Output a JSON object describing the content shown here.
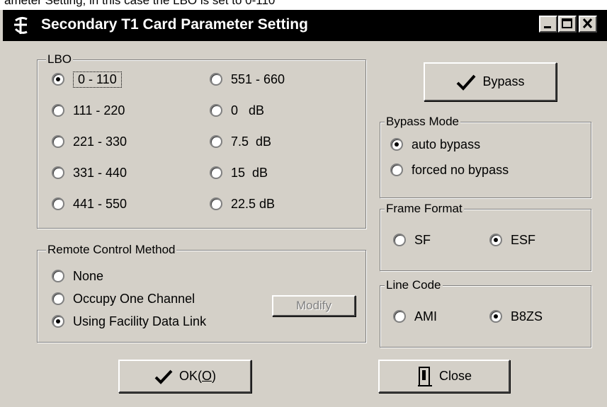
{
  "top_strip": {
    "text": "ameter Setting, in this case the LBO is set to 0-110"
  },
  "window": {
    "title": "Secondary T1 Card Parameter Setting"
  },
  "lbo": {
    "legend": "LBO",
    "options": [
      {
        "label": "0 - 110",
        "selected": true
      },
      {
        "label": "111 - 220",
        "selected": false
      },
      {
        "label": "221 - 330",
        "selected": false
      },
      {
        "label": "331 - 440",
        "selected": false
      },
      {
        "label": "441 - 550",
        "selected": false
      },
      {
        "label": "551 - 660",
        "selected": false
      },
      {
        "label": "0   dB",
        "selected": false
      },
      {
        "label": "7.5  dB",
        "selected": false
      },
      {
        "label": "15  dB",
        "selected": false
      },
      {
        "label": "22.5 dB",
        "selected": false
      }
    ]
  },
  "remote_control": {
    "legend": "Remote Control Method",
    "options": [
      {
        "label": "None",
        "selected": false
      },
      {
        "label": "Occupy One Channel",
        "selected": false
      },
      {
        "label": "Using Facility Data Link",
        "selected": true
      }
    ],
    "modify_label": "Modify"
  },
  "bypass_button": {
    "label": "Bypass"
  },
  "bypass_mode": {
    "legend": "Bypass Mode",
    "options": [
      {
        "label": "auto bypass",
        "selected": true
      },
      {
        "label": "forced no bypass",
        "selected": false
      }
    ]
  },
  "frame_format": {
    "legend": "Frame Format",
    "options": [
      {
        "label": "SF",
        "selected": false
      },
      {
        "label": "ESF",
        "selected": true
      }
    ]
  },
  "line_code": {
    "legend": "Line Code",
    "options": [
      {
        "label": "AMI",
        "selected": false
      },
      {
        "label": "B8ZS",
        "selected": true
      }
    ]
  },
  "ok_button": {
    "label_prefix": "OK(",
    "mnemonic": "O",
    "label_suffix": ")"
  },
  "close_button": {
    "label": "Close"
  },
  "icons": {
    "app": "app-logo-icon",
    "check": "checkmark-icon",
    "close": "exit-door-icon"
  },
  "colors": {
    "face": "#d4d0c8",
    "titlebar": "#000000",
    "title_text": "#ffffff",
    "disabled_text": "#808080"
  }
}
